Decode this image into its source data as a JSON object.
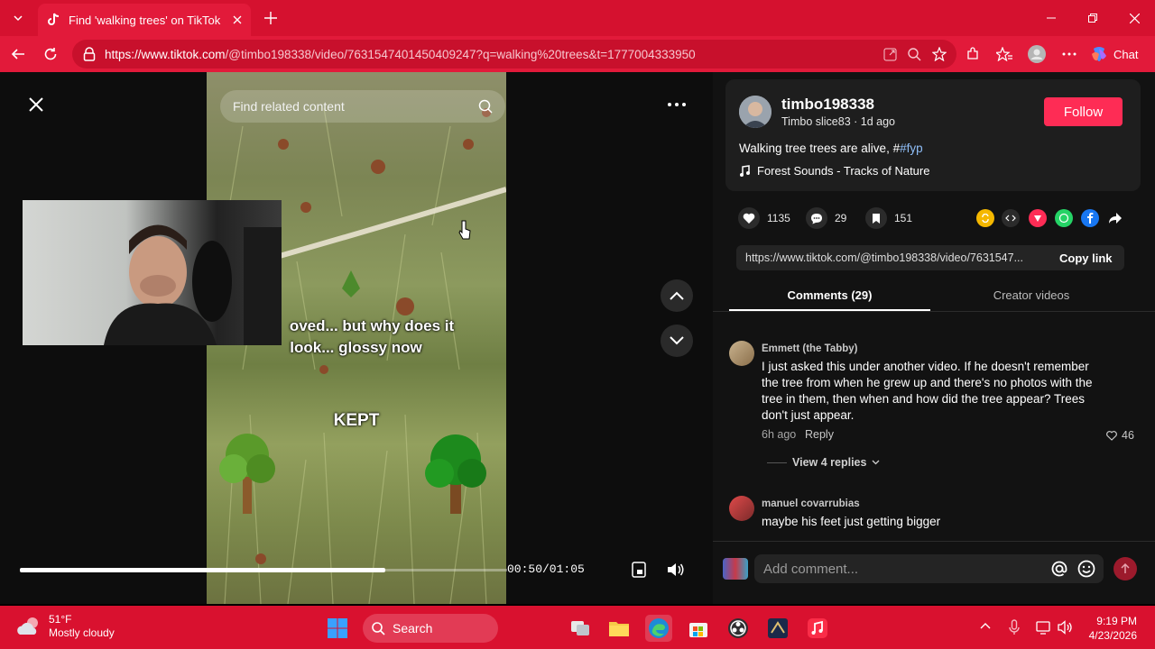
{
  "browser": {
    "tab_title": "Find 'walking trees' on TikTok",
    "url_host": "https://www.tiktok.com",
    "url_path": "/@timbo198338/video/7631547401450409247?q=walking%20trees&t=1777004333950",
    "chat_label": "Chat"
  },
  "player": {
    "search_placeholder": "Find related content",
    "caption_line1": "oved... but why does it",
    "caption_line2": "look... glossy now",
    "caption_kept": "KEPT",
    "timecode": "00:50/01:05",
    "progress": 0.75
  },
  "post": {
    "username": "timbo198338",
    "subline": "Timbo slice83 · 1d ago",
    "follow_label": "Follow",
    "description": "Walking tree trees are alive, #",
    "hashtag": "#fyp",
    "music": "Forest Sounds - Tracks of Nature",
    "likes": "1135",
    "comments": "29",
    "saves": "151",
    "link_url": "https://www.tiktok.com/@timbo198338/video/7631547...",
    "copy_link_label": "Copy link"
  },
  "tabs": {
    "comments": "Comments (29)",
    "creator": "Creator videos"
  },
  "comments": [
    {
      "name": "Emmett (the Tabby)",
      "text": "I just asked this under another video. If he doesn't remember the tree from when he grew up and there's no photos with the tree in them, then when and how did the tree appear? Trees don't just appear.",
      "time": "6h ago",
      "reply": "Reply",
      "likes": "46",
      "view_replies": "View 4 replies"
    },
    {
      "name": "manuel covarrubias",
      "text": "maybe his feet just getting bigger"
    }
  ],
  "comment_input": {
    "placeholder": "Add comment..."
  },
  "taskbar": {
    "temp": "51°F",
    "weather": "Mostly cloudy",
    "search": "Search",
    "time": "9:19 PM",
    "date": "4/23/2026"
  },
  "colors": {
    "browser_red": "#d5112f",
    "follow": "#fe2c55",
    "hashtag": "#8fbef8"
  }
}
